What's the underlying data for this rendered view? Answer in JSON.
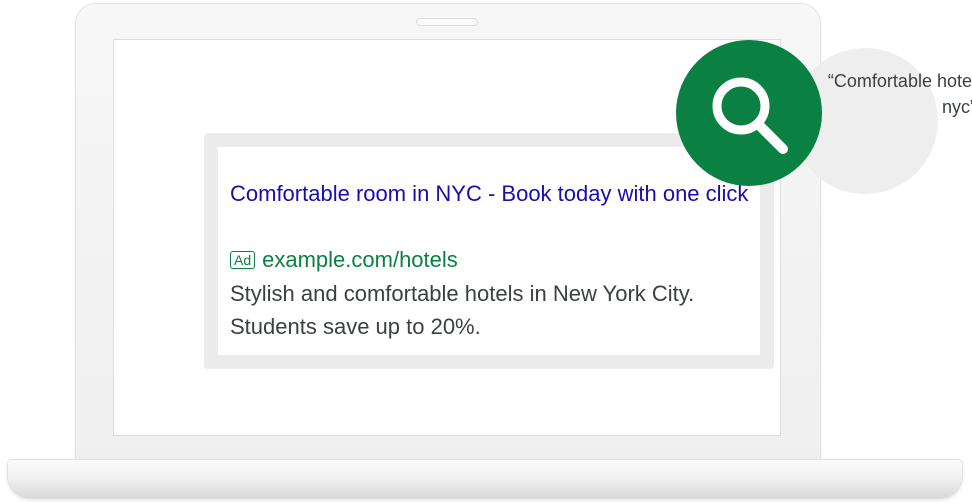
{
  "ad": {
    "headline": "Comfortable room in NYC - Book today with one click",
    "badge": "Ad",
    "display_url": "example.com/hotels",
    "description": "Stylish and comfortable hotels in New York City. Students save up to 20%."
  },
  "search": {
    "query": "“Comfortable hotel nyc”",
    "icon": "search-icon"
  },
  "colors": {
    "headline_link": "#1a0dab",
    "url_green": "#0b8043",
    "search_circle": "#0b8043",
    "bubble": "#eeeeee",
    "panel": "#ececec",
    "body_text": "#3c4043"
  }
}
